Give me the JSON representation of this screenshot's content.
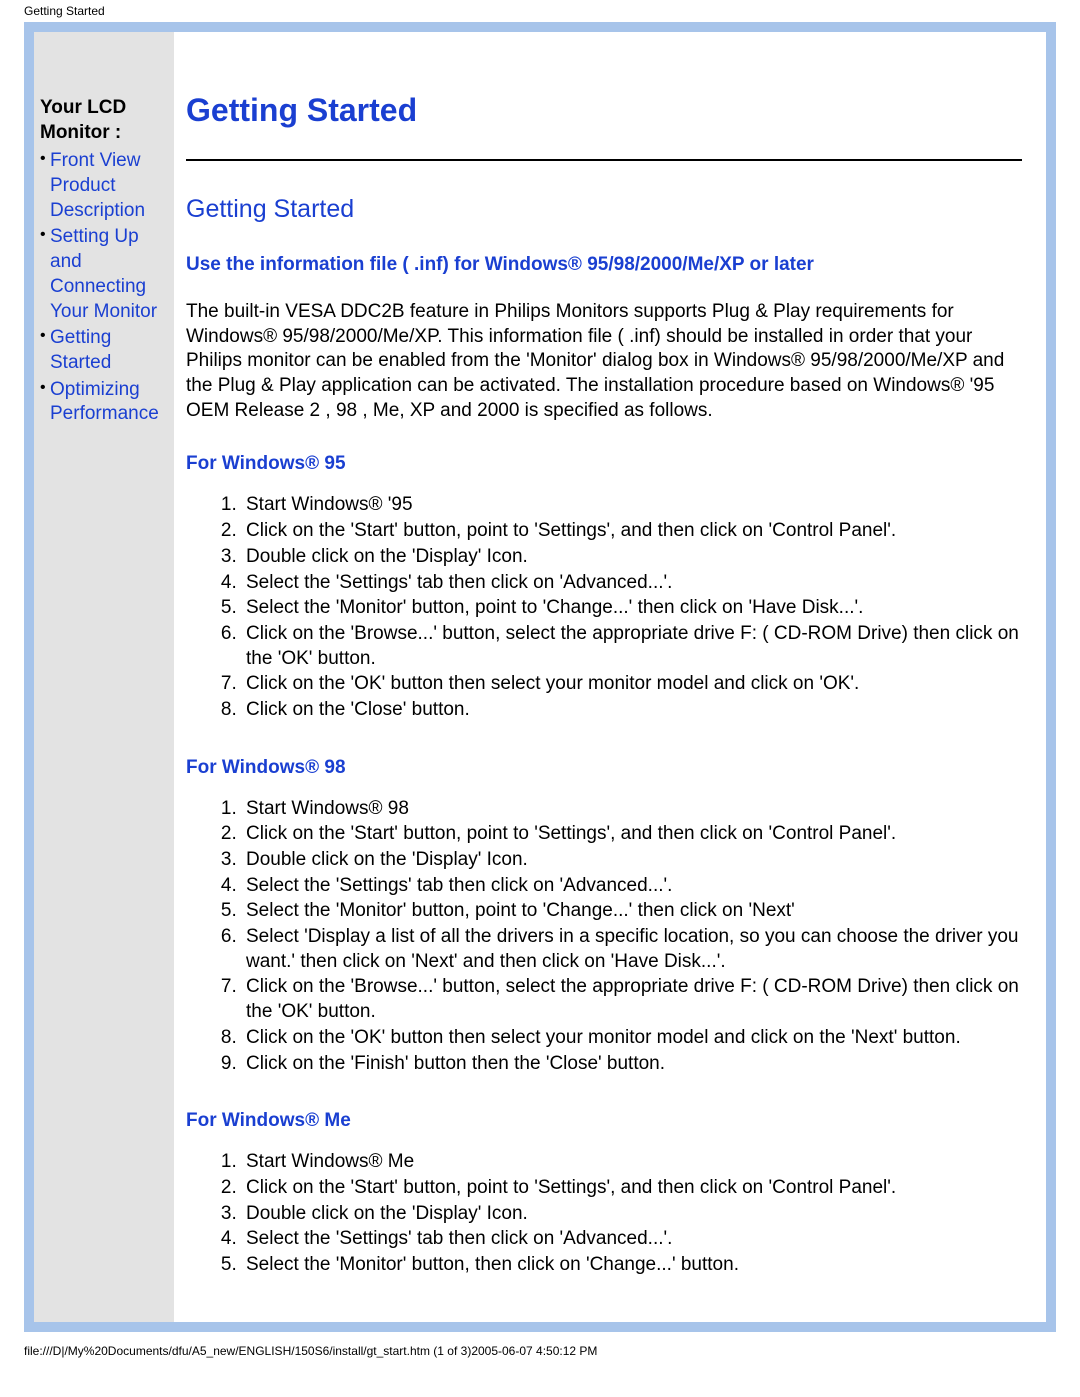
{
  "header_text": "Getting Started",
  "footer_text": "file:///D|/My%20Documents/dfu/A5_new/ENGLISH/150S6/install/gt_start.htm (1 of 3)2005-06-07 4:50:12 PM",
  "sidebar": {
    "title": "Your LCD Monitor :",
    "items": [
      {
        "label": "Front View Product Description"
      },
      {
        "label": "Setting Up and Connecting Your Monitor"
      },
      {
        "label": "Getting Started"
      },
      {
        "label": "Optimizing Performance"
      }
    ]
  },
  "main": {
    "title": "Getting Started",
    "section_title": "Getting Started",
    "sub_heading": "Use the information file ( .inf) for Windows® 95/98/2000/Me/XP or later",
    "intro_paragraph": "The built-in VESA DDC2B feature in Philips Monitors supports Plug & Play requirements for Windows® 95/98/2000/Me/XP. This information file ( .inf) should be installed in order that your Philips monitor can be enabled from the 'Monitor' dialog box in Windows® 95/98/2000/Me/XP and the Plug & Play application can be activated. The installation procedure based on Windows® '95 OEM Release 2 , 98 , Me, XP and 2000 is specified as follows.",
    "sections": [
      {
        "heading": "For Windows® 95",
        "steps": [
          "Start Windows® '95",
          "Click on the 'Start' button, point to 'Settings', and then click on 'Control Panel'.",
          "Double click on the 'Display' Icon.",
          "Select the 'Settings' tab then click on 'Advanced...'.",
          "Select the 'Monitor' button, point to 'Change...' then click on 'Have Disk...'.",
          "Click on the 'Browse...' button, select the appropriate drive F: ( CD-ROM Drive) then click on the 'OK' button.",
          "Click on the 'OK' button then select your monitor model and click on 'OK'.",
          "Click on the 'Close' button."
        ]
      },
      {
        "heading": "For Windows® 98",
        "steps": [
          "Start Windows® 98",
          "Click on the 'Start' button, point to 'Settings', and then click on 'Control Panel'.",
          "Double click on the 'Display' Icon.",
          "Select the 'Settings' tab then click on 'Advanced...'.",
          "Select the 'Monitor' button, point to 'Change...' then click on 'Next'",
          "Select 'Display a list of all the drivers in a specific location, so you can choose the driver you want.' then click on 'Next' and then click on 'Have Disk...'.",
          "Click on the 'Browse...' button, select the appropriate drive F: ( CD-ROM Drive) then click on the 'OK' button.",
          "Click on the 'OK' button then select your monitor model and click on the 'Next' button.",
          "Click on the 'Finish' button then the 'Close' button."
        ]
      },
      {
        "heading": "For Windows® Me",
        "steps": [
          "Start Windows® Me",
          "Click on the 'Start' button, point to 'Settings', and then click on 'Control Panel'.",
          "Double click on the 'Display' Icon.",
          "Select the 'Settings' tab then click on 'Advanced...'.",
          "Select the 'Monitor' button, then click on 'Change...' button."
        ]
      }
    ]
  }
}
